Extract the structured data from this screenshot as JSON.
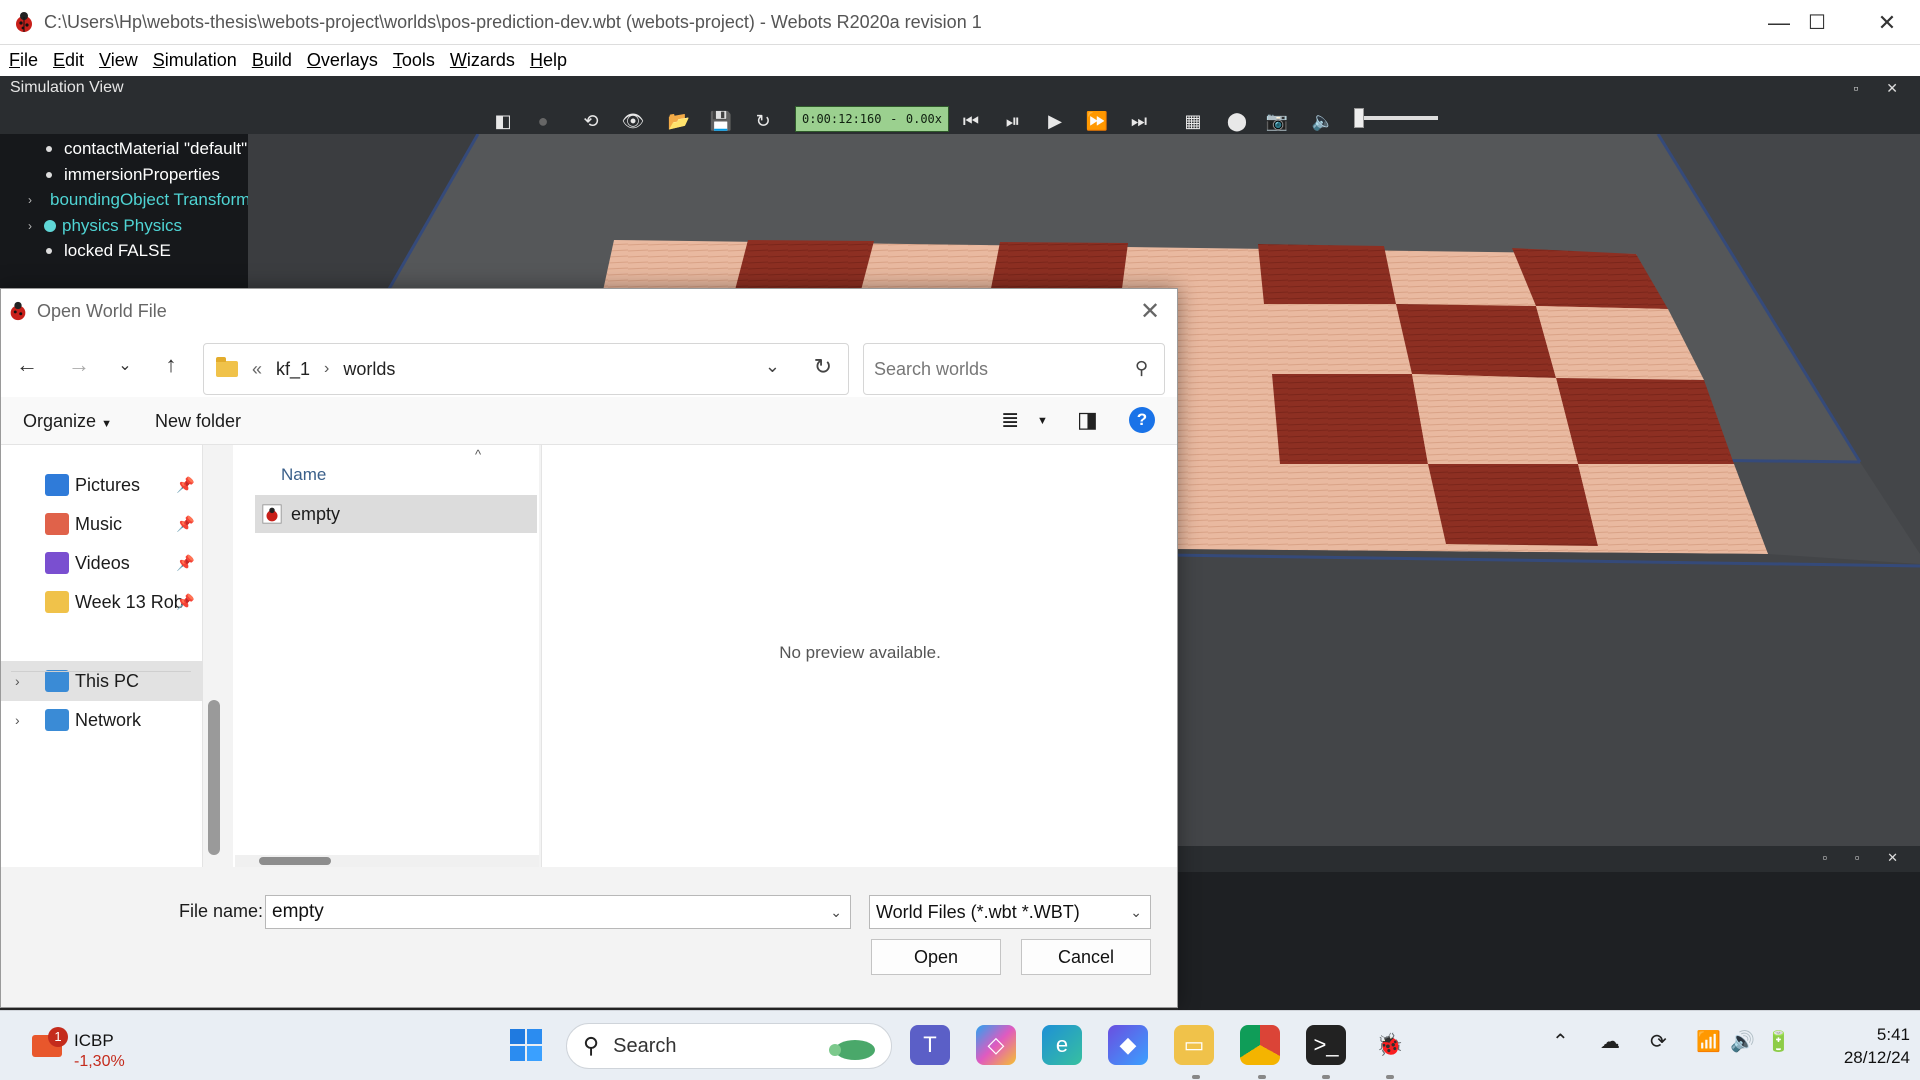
{
  "window": {
    "title": "C:\\Users\\Hp\\webots-thesis\\webots-project\\worlds\\pos-prediction-dev.wbt (webots-project) - Webots R2020a revision 1",
    "minimize": "—",
    "maximize": "☐",
    "close": "✕"
  },
  "menubar": [
    {
      "first": "F",
      "rest": "ile"
    },
    {
      "first": "E",
      "rest": "dit"
    },
    {
      "first": "V",
      "rest": "iew"
    },
    {
      "first": "S",
      "rest": "imulation"
    },
    {
      "first": "B",
      "rest": "uild"
    },
    {
      "first": "O",
      "rest": "verlays"
    },
    {
      "first": "T",
      "rest": "ools"
    },
    {
      "first": "W",
      "rest": "izards"
    },
    {
      "first": "H",
      "rest": "elp"
    }
  ],
  "simulation_view": {
    "header": "Simulation View",
    "time": "0:00:12:160",
    "time_sep": "-",
    "speed": "0.00x",
    "volume_level": 0
  },
  "scene_tree": [
    {
      "label": "contactMaterial \"default\"",
      "style": "plain"
    },
    {
      "label": "immersionProperties",
      "style": "plain"
    },
    {
      "label": "boundingObject Transform",
      "style": "node"
    },
    {
      "label": "physics Physics",
      "style": "node"
    },
    {
      "label": "locked FALSE",
      "style": "plain"
    }
  ],
  "dialog": {
    "title": "Open World File",
    "address": {
      "overflow": "«",
      "crumbs": [
        "kf_1",
        "worlds"
      ]
    },
    "search_placeholder": "Search worlds",
    "organize": "Organize",
    "new_folder": "New folder",
    "help": "?",
    "nav_items": [
      {
        "label": "Pictures",
        "icon": "pictures-icon",
        "color": "#2f7bd9",
        "pinned": true
      },
      {
        "label": "Music",
        "icon": "music-icon",
        "color": "#e0624a",
        "pinned": true
      },
      {
        "label": "Videos",
        "icon": "videos-icon",
        "color": "#7a4fd0",
        "pinned": true
      },
      {
        "label": "Week 13 Rob",
        "icon": "folder-icon",
        "color": "#f0c24a",
        "pinned": true
      },
      {
        "label": "This PC",
        "icon": "computer-icon",
        "color": "#3a8bd6",
        "expandable": true,
        "selected": true
      },
      {
        "label": "Network",
        "icon": "network-icon",
        "color": "#3a8bd6",
        "expandable": true
      }
    ],
    "column_name": "Name",
    "files": [
      {
        "name": "empty",
        "icon": "webots-world-icon"
      }
    ],
    "preview_message": "No preview available.",
    "file_name_label": "File name:",
    "file_name_value": "empty",
    "file_type": "World Files (*.wbt *.WBT)",
    "open_button": "Open",
    "cancel_button": "Cancel"
  },
  "taskbar": {
    "stock_name": "ICBP",
    "stock_change": "-1,30%",
    "stock_badge": "1",
    "search_label": "Search",
    "clock_time": "5:41",
    "clock_date": "28/12/24"
  },
  "colors": {
    "accent": "#1a73e8",
    "tree_node": "#4fd4d4",
    "time_box": "#9bd08f",
    "stock_negative": "#c42b1c"
  }
}
